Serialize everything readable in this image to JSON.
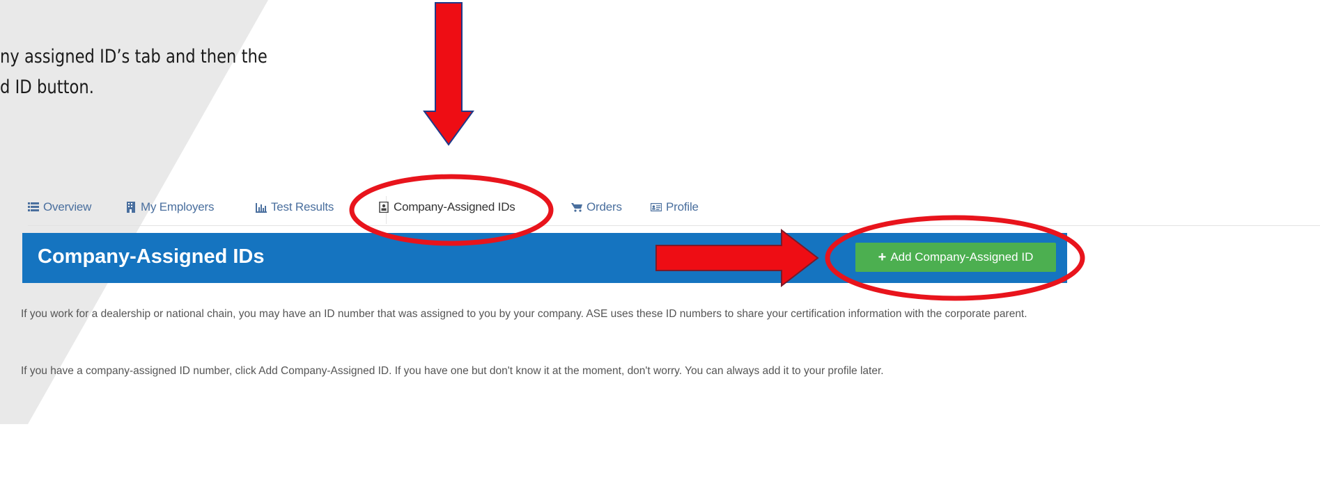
{
  "instruction": {
    "line1": "ny assigned ID’s tab and then the",
    "line2": "d ID button."
  },
  "tabs": [
    {
      "label": "Overview",
      "icon": "list-icon"
    },
    {
      "label": "My Employers",
      "icon": "building-icon"
    },
    {
      "label": "Test Results",
      "icon": "bar-chart-icon"
    },
    {
      "label": "Company-Assigned IDs",
      "icon": "id-badge-icon",
      "active": true
    },
    {
      "label": "Orders",
      "icon": "cart-icon"
    },
    {
      "label": "Profile",
      "icon": "id-card-icon"
    }
  ],
  "header": {
    "title": "Company-Assigned IDs",
    "add_button_label": "Add Company-Assigned ID"
  },
  "content": {
    "paragraph1": "If you work for a dealership or national chain, you may have an ID number that was assigned to you by your company. ASE uses these ID numbers to share your certification information with the corporate parent.",
    "paragraph2": "If you have a company-assigned ID number, click Add Company-Assigned ID. If you have one but don't know it at the moment, don't worry. You can always add it to your profile later."
  },
  "colors": {
    "header_bg": "#1574c0",
    "button_bg": "#4caf50",
    "annotation_red": "#e8141c",
    "tab_link": "#4a6f9e"
  }
}
